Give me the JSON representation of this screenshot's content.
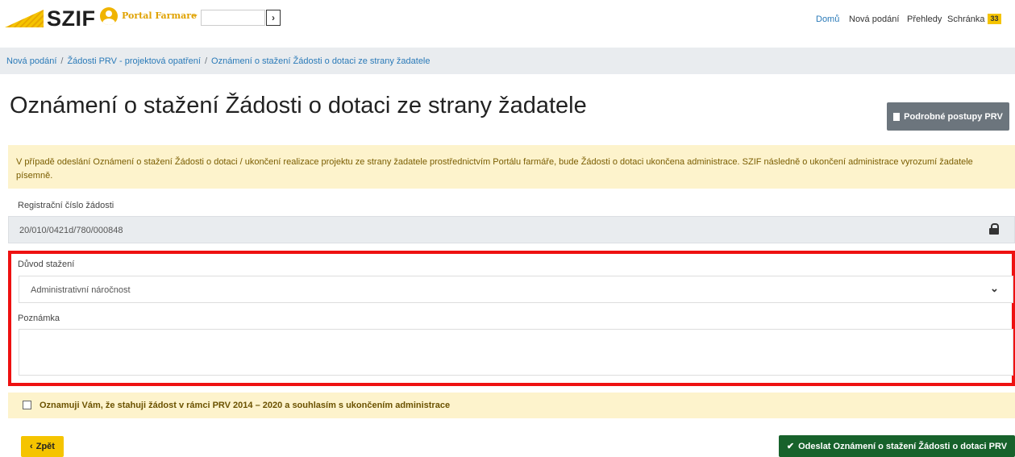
{
  "header": {
    "logo": "SZIF",
    "portal_label": "Portal Farmare",
    "nav": [
      "Domů",
      "Nová podání",
      "Přehledy",
      "Schránka"
    ],
    "inbox_count": "33",
    "accent_color": "#f5c400"
  },
  "breadcrumb": {
    "items": [
      "Nová podání",
      "Žádosti PRV - projektová opatření",
      "Oznámení o stažení Žádosti o dotaci ze strany žadatele"
    ]
  },
  "page": {
    "title": "Oznámení o stažení Žádosti o dotaci ze strany žadatele",
    "procedures_button": "Podrobné postupy PRV"
  },
  "alert": {
    "text": "V případě odeslání Oznámení o stažení Žádosti o dotaci / ukončení realizace projektu ze strany žadatele prostřednictvím Portálu farmáře, bude Žádosti o dotaci ukončena administrace. SZIF následně o ukončení administrace vyrozumí žadatele písemně."
  },
  "form": {
    "registration_label": "Registrační číslo žádosti",
    "registration_value": "20/010/0421d/780/000848",
    "reason_label": "Důvod stažení",
    "reason_value": "Administrativní náročnost",
    "note_label": "Poznámka",
    "note_value": "",
    "consent_label": "Oznamuji Vám, že stahuji žádost v rámci PRV 2014 – 2020 a souhlasím s ukončením administrace",
    "consent_checked": false
  },
  "actions": {
    "back_label": "Zpět",
    "submit_label": "Odeslat Oznámení o stažení Žádosti o dotaci PRV",
    "submit_color": "#17622b"
  }
}
